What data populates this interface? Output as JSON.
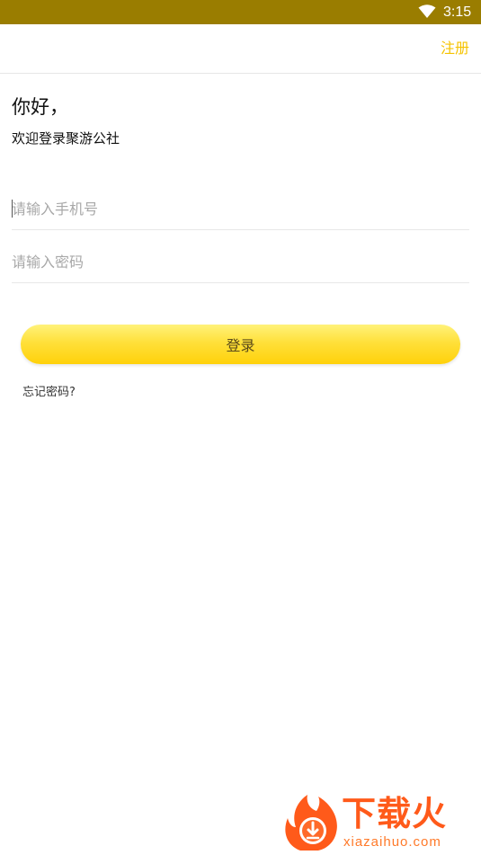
{
  "status_bar": {
    "time": "3:15",
    "wifi_icon": "wifi-icon",
    "background_color": "#9a7d00"
  },
  "header": {
    "register_label": "注册"
  },
  "greeting": {
    "title": "你好，",
    "subtitle": "欢迎登录聚游公社"
  },
  "form": {
    "phone_placeholder": "请输入手机号",
    "phone_value": "",
    "password_placeholder": "请输入密码",
    "password_value": "",
    "login_label": "登录",
    "forgot_label": "忘记密码?"
  },
  "watermark": {
    "brand": "下载火",
    "url": "xiazaihuo.com"
  },
  "colors": {
    "accent": "#f5c300",
    "button_gradient_top": "#fff27a",
    "button_gradient_bottom": "#ffd10a",
    "watermark": "#ff5a1a"
  }
}
